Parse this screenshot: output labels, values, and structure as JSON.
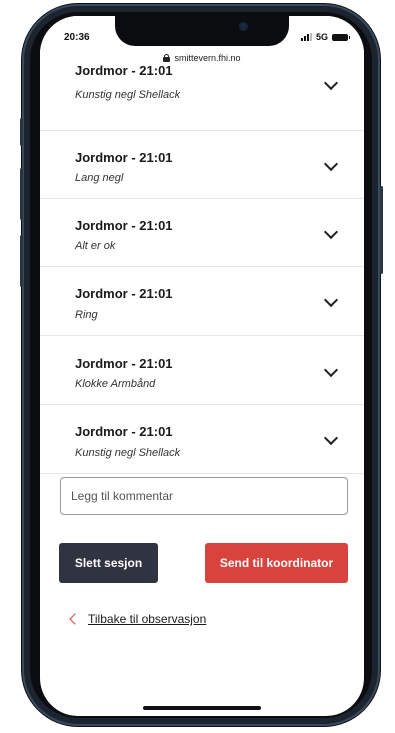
{
  "status_bar": {
    "time": "20:36",
    "network": "5G",
    "url": "smittevern.fhi.no"
  },
  "observations": [
    {
      "title": "Jordmor - 21:01",
      "subtitle": "Kunstig negl Shellack"
    },
    {
      "title": "Jordmor - 21:01",
      "subtitle": "Lang negl"
    },
    {
      "title": "Jordmor - 21:01",
      "subtitle": "Alt er ok"
    },
    {
      "title": "Jordmor - 21:01",
      "subtitle": "Ring"
    },
    {
      "title": "Jordmor - 21:01",
      "subtitle": "Klokke Armbånd"
    },
    {
      "title": "Jordmor - 21:01",
      "subtitle": "Kunstig negl Shellack"
    }
  ],
  "comment": {
    "placeholder": "Legg til kommentar",
    "value": ""
  },
  "actions": {
    "delete_label": "Slett sesjon",
    "send_label": "Send til koordinator",
    "back_label": "Tilbake til observasjon"
  },
  "colors": {
    "primary_red": "#d9433d",
    "dark_button": "#2f3440"
  }
}
